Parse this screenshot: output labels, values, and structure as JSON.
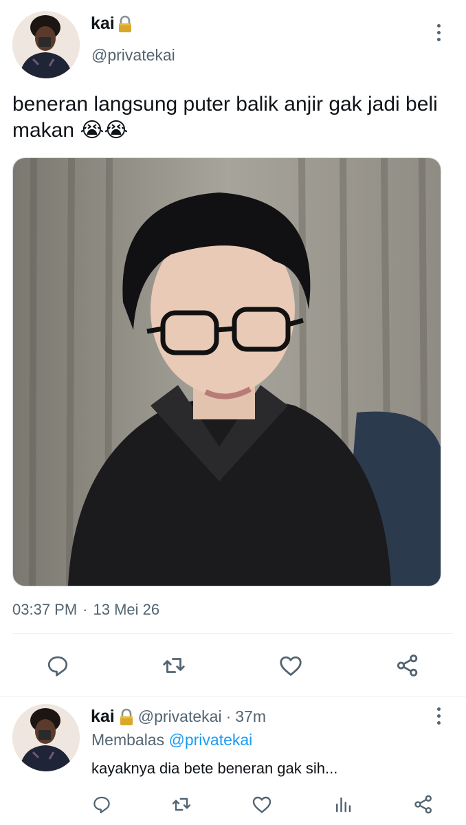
{
  "main_tweet": {
    "author_name": "kai",
    "author_handle": "@privatekai",
    "text": "beneran langsung puter balik anjir gak jadi beli makan 😭😭",
    "time": "03:37 PM",
    "separator": "·",
    "date": "13 Mei 26",
    "icons": {
      "lock": "lock-icon",
      "more": "more-icon",
      "reply": "reply-icon",
      "retweet": "retweet-icon",
      "like": "like-icon",
      "share": "share-icon"
    }
  },
  "reply_tweet": {
    "author_name": "kai",
    "author_handle": "@privatekai",
    "separator": "·",
    "time_ago": "37m",
    "replying_label": "Membalas",
    "replying_to": "@privatekai",
    "text": "kayaknya dia bete beneran gak sih...",
    "icons": {
      "reply": "reply-icon",
      "retweet": "retweet-icon",
      "like": "like-icon",
      "views": "views-icon",
      "share": "share-icon"
    }
  },
  "colors": {
    "text": "#0f1419",
    "secondary": "#536471",
    "link": "#1d9bf0",
    "divider": "#eff3f4"
  }
}
